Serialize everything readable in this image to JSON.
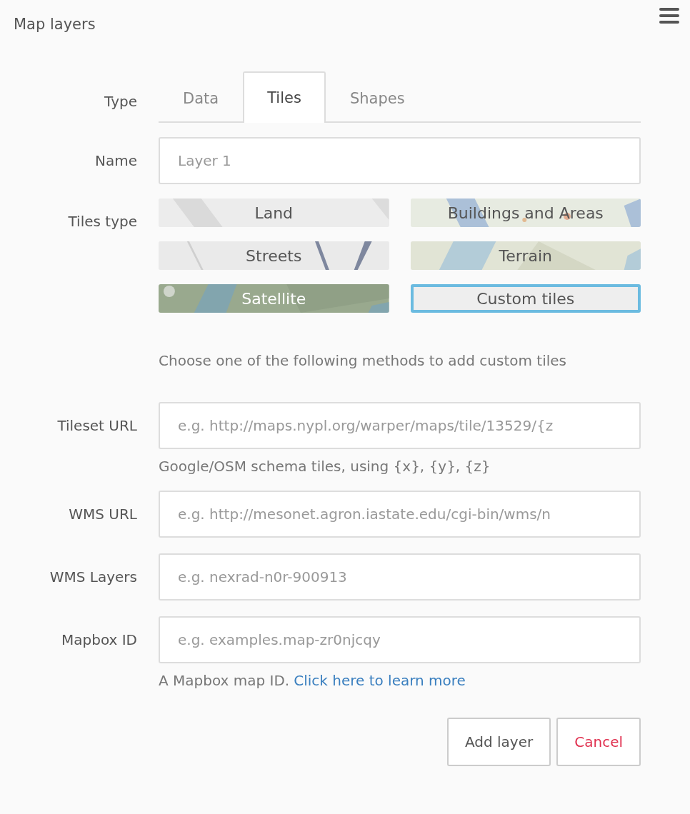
{
  "panel": {
    "title": "Map layers"
  },
  "type_label": "Type",
  "tabs": [
    {
      "label": "Data",
      "selected": false
    },
    {
      "label": "Tiles",
      "selected": true
    },
    {
      "label": "Shapes",
      "selected": false
    }
  ],
  "name_field": {
    "label": "Name",
    "placeholder": "Layer 1"
  },
  "tiles_type": {
    "label": "Tiles type",
    "options": [
      {
        "label": "Land",
        "kind": "land",
        "selected": false
      },
      {
        "label": "Buildings and Areas",
        "kind": "buildings",
        "selected": false
      },
      {
        "label": "Streets",
        "kind": "streets",
        "selected": false
      },
      {
        "label": "Terrain",
        "kind": "terrain",
        "selected": false
      },
      {
        "label": "Satellite",
        "kind": "satellite",
        "selected": false
      },
      {
        "label": "Custom tiles",
        "kind": "plain",
        "selected": true
      }
    ]
  },
  "custom_hint": "Choose one of the following methods to add custom tiles",
  "fields": [
    {
      "label": "Tileset URL",
      "placeholder": "e.g. http://maps.nypl.org/warper/maps/tile/13529/{z",
      "help": "Google/OSM schema tiles, using {x}, {y}, {z}"
    },
    {
      "label": "WMS URL",
      "placeholder": "e.g. http://mesonet.agron.iastate.edu/cgi-bin/wms/n"
    },
    {
      "label": "WMS Layers",
      "placeholder": "e.g. nexrad-n0r-900913"
    },
    {
      "label": "Mapbox ID",
      "placeholder": "e.g. examples.map-zr0njcqy",
      "help": "A Mapbox map ID.",
      "help_link": "Click here to learn more"
    }
  ],
  "buttons": [
    {
      "label": "Add layer",
      "kind": "primary"
    },
    {
      "label": "Cancel",
      "kind": "danger"
    }
  ]
}
